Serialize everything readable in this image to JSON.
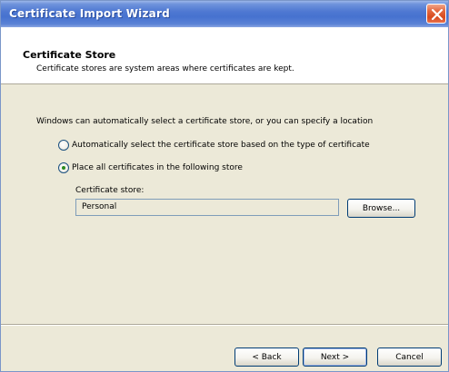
{
  "window": {
    "title": "Certificate Import Wizard",
    "close_icon": "close-icon"
  },
  "header": {
    "title": "Certificate Store",
    "subtitle": "Certificate stores are system areas where certificates are kept."
  },
  "main": {
    "intro": "Windows can automatically select a certificate store, or you can specify a location",
    "options": [
      {
        "label": "Automatically select the certificate store based on the type of certificate",
        "selected": false
      },
      {
        "label": "Place all certificates in the following store",
        "selected": true
      }
    ],
    "store_label": "Certificate store:",
    "store_value": "Personal",
    "browse_label": "Browse..."
  },
  "footer": {
    "back_label": "< Back",
    "next_label": "Next >",
    "cancel_label": "Cancel"
  },
  "colors": {
    "titlebar": "#4672cf",
    "window_bg": "#ece9d8",
    "close_button": "#d74a1e"
  }
}
